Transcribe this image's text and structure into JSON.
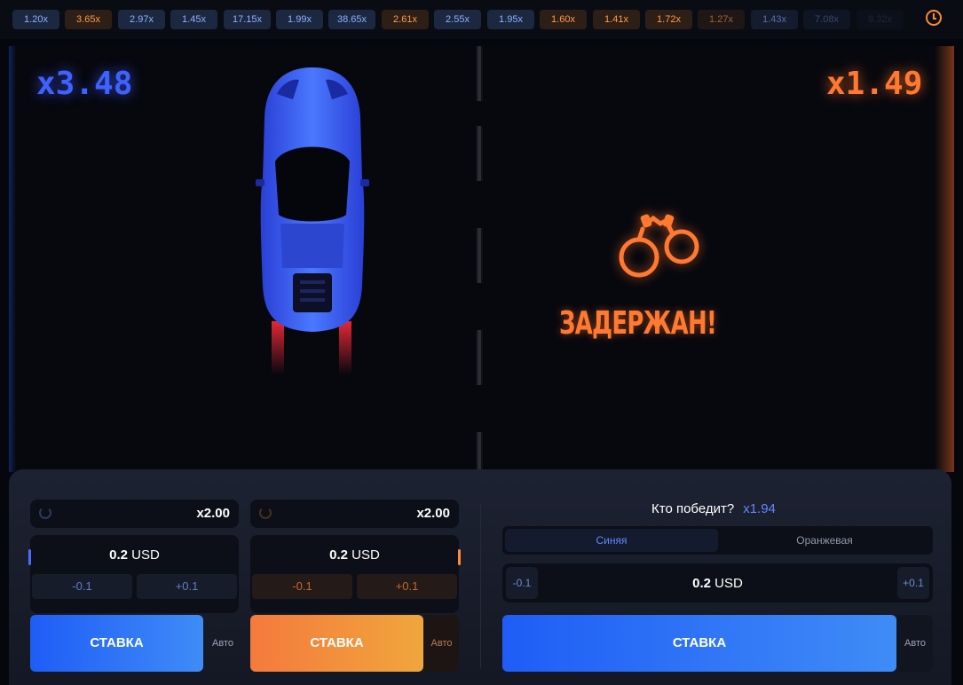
{
  "history": [
    {
      "label": "1.20x",
      "color": "blue"
    },
    {
      "label": "3.65x",
      "color": "orange"
    },
    {
      "label": "2.97x",
      "color": "blue"
    },
    {
      "label": "1.45x",
      "color": "blue"
    },
    {
      "label": "17.15x",
      "color": "blue"
    },
    {
      "label": "1.99x",
      "color": "blue"
    },
    {
      "label": "38.65x",
      "color": "blue"
    },
    {
      "label": "2.61x",
      "color": "orange"
    },
    {
      "label": "2.55x",
      "color": "blue"
    },
    {
      "label": "1.95x",
      "color": "blue"
    },
    {
      "label": "1.60x",
      "color": "orange"
    },
    {
      "label": "1.41x",
      "color": "orange"
    },
    {
      "label": "1.72x",
      "color": "orange"
    },
    {
      "label": "1.27x",
      "color": "orange"
    },
    {
      "label": "1.43x",
      "color": "blue"
    },
    {
      "label": "7.08x",
      "color": "blue"
    },
    {
      "label": "9.32x",
      "color": "blue"
    }
  ],
  "game": {
    "blue_multiplier": "x3.48",
    "orange_multiplier": "x1.49",
    "status": "ЗАДЕРЖАН!"
  },
  "colors": {
    "blue_accent": "#3f62ff",
    "orange_accent": "#ff7a30",
    "bet_blue": "#1f5df6",
    "bet_orange": "#f47a3c"
  },
  "bet_blue": {
    "autocash": "x2.00",
    "amount": "0.2",
    "currency": "USD",
    "minus": "-0.1",
    "plus": "+0.1",
    "button": "СТАВКА",
    "auto": "Авто"
  },
  "bet_orange": {
    "autocash": "x2.00",
    "amount": "0.2",
    "currency": "USD",
    "minus": "-0.1",
    "plus": "+0.1",
    "button": "СТАВКА",
    "auto": "Авто"
  },
  "winner": {
    "question": "Кто победит?",
    "odds": "x1.94",
    "tabs": [
      "Синяя",
      "Оранжевая"
    ],
    "selected": "Синяя",
    "minus": "-0.1",
    "plus": "+0.1",
    "amount": "0.2",
    "currency": "USD",
    "button": "СТАВКА",
    "auto": "Авто"
  }
}
